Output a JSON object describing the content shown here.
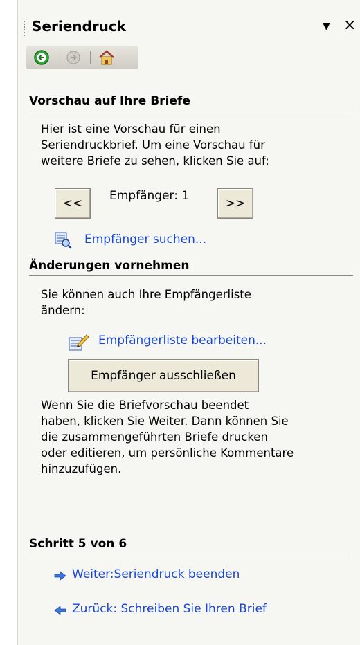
{
  "pane": {
    "title": "Seriendruck",
    "dropdown_glyph": "▼",
    "close_glyph": "×"
  },
  "nav": {
    "back_icon": "green-back-arrow",
    "forward_icon": "gray-forward-arrow",
    "home_icon": "home"
  },
  "preview": {
    "heading": "Vorschau auf Ihre Briefe",
    "text_lines": [
      "Hier ist eine Vorschau für einen",
      "Seriendruckbrief. Um eine Vorschau für",
      "weitere Briefe zu sehen, klicken Sie auf:"
    ],
    "prev_label": "<<",
    "recipient_label": "Empfänger: 1",
    "next_label": ">>",
    "find_link": "Empfänger suchen..."
  },
  "changes": {
    "heading": "Änderungen vornehmen",
    "text_lines": [
      "Sie können auch Ihre Empfängerliste",
      "ändern:"
    ],
    "edit_link": "Empfängerliste bearbeiten...",
    "exclude_button": "Empfänger ausschließen",
    "info_lines": [
      "Wenn Sie die Briefvorschau beendet",
      "haben, klicken Sie Weiter. Dann können Sie",
      "die zusammengeführten Briefe drucken",
      "oder editieren, um persönliche Kommentare",
      "hinzuzufügen."
    ]
  },
  "step": {
    "heading": "Schritt 5 von 6",
    "next_link": "Weiter:Seriendruck beenden",
    "back_link": "Zurück: Schreiben Sie Ihren Brief"
  },
  "colors": {
    "link": "#1a46d6",
    "pane_bg": "#f6f6f2",
    "arrow_blue": "#3b74d9"
  }
}
